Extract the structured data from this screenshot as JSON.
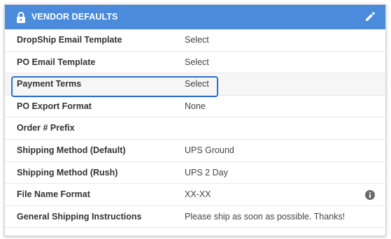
{
  "header": {
    "title": "VENDOR DEFAULTS",
    "lock_icon": "lock-icon",
    "edit_icon": "pencil-icon",
    "background": "#4a8cdb"
  },
  "rows": [
    {
      "label": "DropShip Email Template",
      "value": "Select"
    },
    {
      "label": "PO Email Template",
      "value": "Select"
    },
    {
      "label": "Payment Terms",
      "value": "Select"
    },
    {
      "label": "PO Export Format",
      "value": "None"
    },
    {
      "label": "Order # Prefix",
      "value": ""
    },
    {
      "label": "Shipping Method (Default)",
      "value": "UPS Ground"
    },
    {
      "label": "Shipping Method (Rush)",
      "value": "UPS 2 Day"
    },
    {
      "label": "File Name Format",
      "value": "XX-XX"
    },
    {
      "label": "General Shipping Instructions",
      "value": "Please ship as soon as possible. Thanks!"
    }
  ],
  "highlight_color": "#2b6fd4"
}
